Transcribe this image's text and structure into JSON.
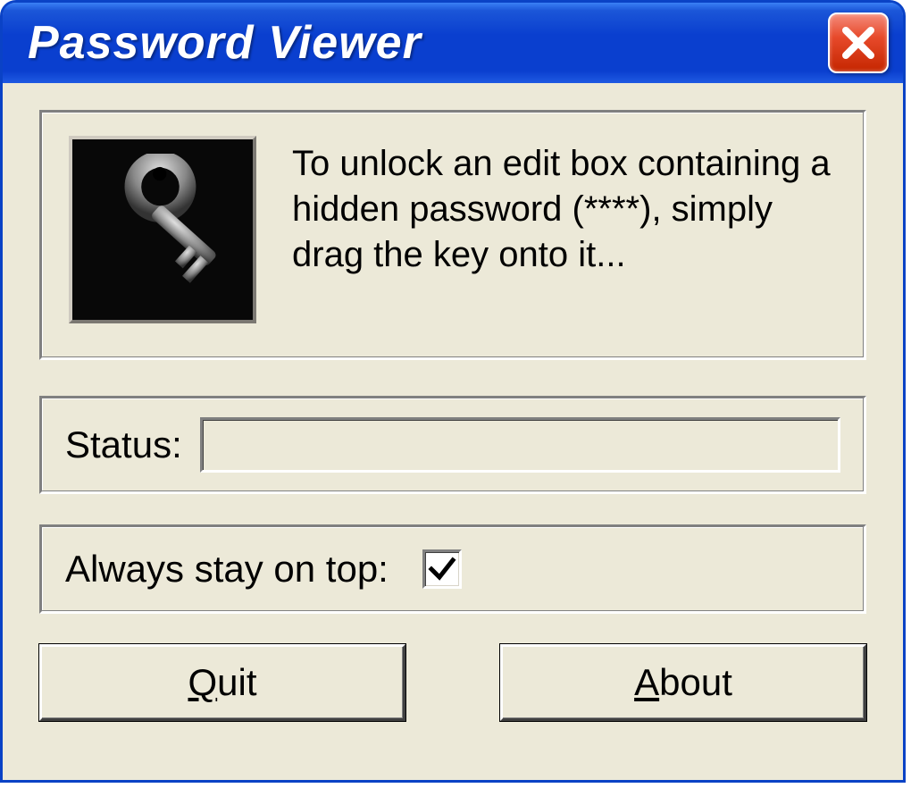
{
  "window": {
    "title": "Password Viewer"
  },
  "instruction": {
    "text": "To unlock an edit box containing a hidden password (****), simply drag the key onto it..."
  },
  "status": {
    "label": "Status:",
    "value": ""
  },
  "always_on_top": {
    "label": "Always stay on top:",
    "checked": true
  },
  "buttons": {
    "quit": {
      "accel": "Q",
      "rest": "uit"
    },
    "about": {
      "accel": "A",
      "rest": "bout"
    }
  },
  "icons": {
    "close": "close-icon",
    "key": "key-icon",
    "check": "checkmark-icon"
  }
}
